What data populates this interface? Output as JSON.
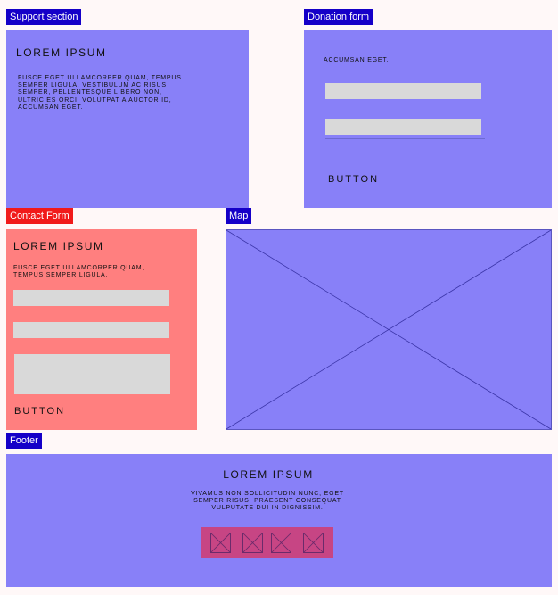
{
  "support_section": {
    "tag": "Support section",
    "title": "LOREM IPSUM",
    "body": "FUSCE EGET ULLAMCORPER QUAM, TEMPUS SEMPER LIGULA. VESTIBULUM AC RISUS SEMPER, PELLENTESQUE LIBERO NON, ULTRICIES ORCI. VOLUTPAT A AUCTOR ID, ACCUMSAN EGET."
  },
  "donation_form": {
    "tag": "Donation form",
    "text": "ACCUMSAN EGET.",
    "button_label": "BUTTON",
    "fields": [
      "",
      ""
    ]
  },
  "contact_form": {
    "tag": "Contact Form",
    "title": "LOREM IPSUM",
    "body": "FUSCE EGET ULLAMCORPER QUAM, TEMPUS SEMPER LIGULA.",
    "button_label": "BUTTON",
    "fields": [
      "",
      "",
      ""
    ]
  },
  "map": {
    "tag": "Map",
    "placeholder_icon": "image-placeholder-icon"
  },
  "footer": {
    "tag": "Footer",
    "title": "LOREM IPSUM",
    "body": "VIVAMUS NON SOLLICITUDIN NUNC, EGET SEMPER RISUS. PRAESENT CONSEQUAT VULPUTATE DUI IN DIGNISSIM.",
    "social_icons": [
      "social-icon-placeholder",
      "social-icon-placeholder",
      "social-icon-placeholder",
      "social-icon-placeholder"
    ]
  },
  "colors": {
    "background": "#fff8f8",
    "panel_blue": "#8880f8",
    "panel_red": "#ff7f7f",
    "tag_blue": "#1500c8",
    "tag_red": "#f11a1a",
    "input_gray": "#d9d9d9",
    "social_bar": "#c74584"
  }
}
